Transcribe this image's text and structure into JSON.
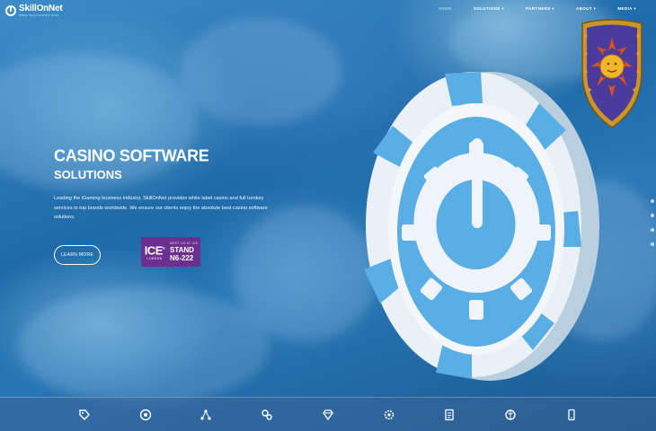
{
  "header": {
    "logo_text": "SkillOnNet",
    "logo_sub": "WWW.SKILLONNET.COM",
    "nav": [
      {
        "label": "HOME",
        "active": true
      },
      {
        "label": "SOLUTIONS",
        "caret": "▾"
      },
      {
        "label": "PARTNERS",
        "caret": "▾"
      },
      {
        "label": "ABOUT",
        "caret": "▾"
      },
      {
        "label": "MEDIA",
        "caret": "▾"
      }
    ]
  },
  "hero": {
    "title_line1": "CASINO SOFTWARE",
    "title_line2": "SOLUTIONS",
    "description": "Leading the iGaming business industry, SkillOnNet provides white label casino and full turnkey services to top brands worldwide. We ensure our clients enjoy the absolute best casino software solutions.",
    "cta_label": "LEARN MORE"
  },
  "ice_badge": {
    "logo": "ICE",
    "logo_mark": "®",
    "city": "LONDON",
    "visit_text": "MEET US AT ICE",
    "stand_label": "STAND",
    "stand_number": "N6-222"
  },
  "bottom_bar": {
    "icons": [
      "tag-icon",
      "casino-chip-icon",
      "network-icon",
      "gears-icon",
      "diamond-icon",
      "settings-icon",
      "document-icon",
      "brain-icon",
      "mobile-icon"
    ]
  },
  "colors": {
    "accent_purple": "#6b2f8f",
    "chip_blue": "#5aaee6",
    "chip_white": "#e6eef5"
  }
}
